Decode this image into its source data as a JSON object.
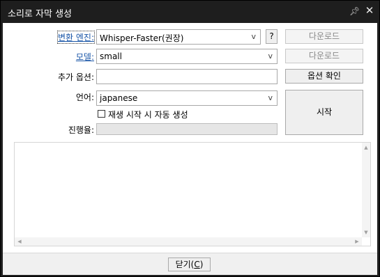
{
  "window": {
    "title": "소리로 자막 생성",
    "pin_icon": "pin-icon",
    "close_icon": "close-icon"
  },
  "form": {
    "engine_label": "변환 엔진:",
    "engine_value": "Whisper-Faster(권장)",
    "help_label": "?",
    "engine_download_label": "다운로드",
    "model_label": "모델:",
    "model_value": "small",
    "model_download_label": "다운로드",
    "options_label": "추가 옵션:",
    "options_value": "",
    "options_check_label": "옵션 확인",
    "language_label": "언어:",
    "language_value": "japanese",
    "autostart_label": "재생 시작 시 자동 생성",
    "autostart_checked": false,
    "progress_label": "진행율:",
    "progress_value": 0,
    "start_label": "시작"
  },
  "log": {
    "text": ""
  },
  "footer": {
    "close_label": "닫기(",
    "close_key": "C",
    "close_suffix": ")"
  }
}
